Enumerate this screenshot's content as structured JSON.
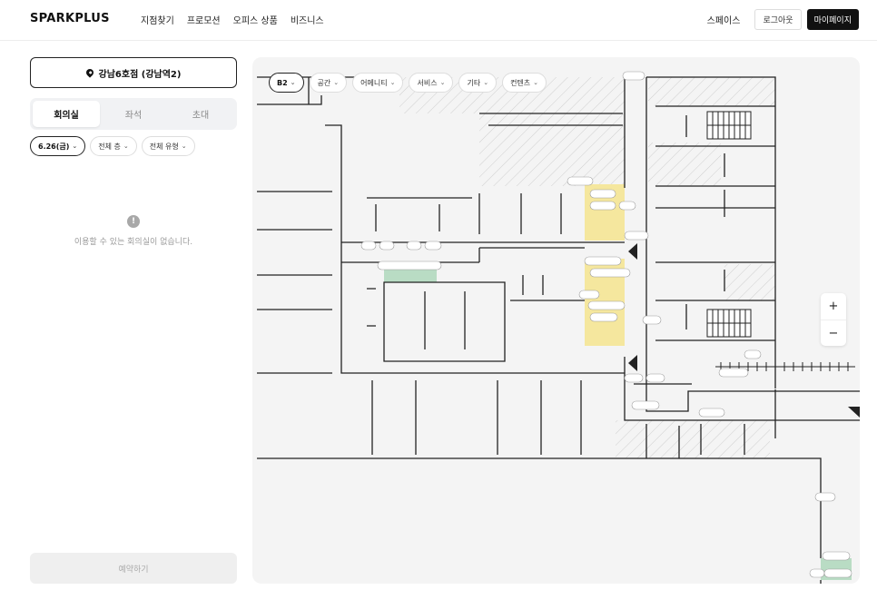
{
  "header": {
    "logo": "SPARKPLUS",
    "nav": [
      "지점찾기",
      "프로모션",
      "오피스 상품",
      "비즈니스"
    ],
    "space_link": "스페이스",
    "logout": "로그아웃",
    "mypage": "마이페이지"
  },
  "sidebar": {
    "branch": "강남6호점 (강남역2)",
    "tabs": [
      {
        "label": "회의실",
        "active": true
      },
      {
        "label": "좌석",
        "active": false
      },
      {
        "label": "초대",
        "active": false
      }
    ],
    "filters": {
      "date": "6.26(금)",
      "floor": "전체 층",
      "type": "전체 유형"
    },
    "empty_icon": "!",
    "empty_message": "이용할 수 있는 회의실이 없습니다.",
    "reserve": "예약하기"
  },
  "map": {
    "floor": "B2",
    "filters": [
      "공간",
      "어메니티",
      "서비스",
      "기타",
      "컨텐츠"
    ],
    "zoom_in": "+",
    "zoom_out": "−",
    "colors": {
      "background": "#f4f4f4",
      "wall": "#222222",
      "highlight_yellow": "#f5e79e",
      "highlight_green": "#b9dcc4",
      "hatch": "#cfcfcf"
    }
  }
}
